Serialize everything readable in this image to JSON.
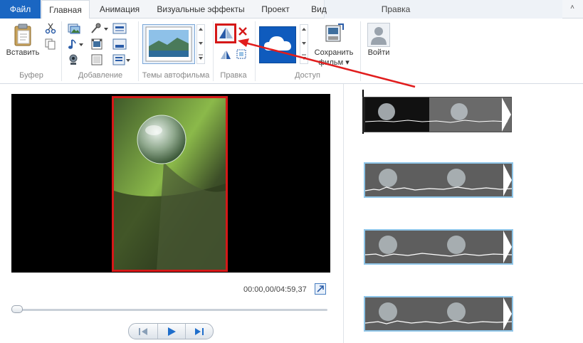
{
  "tabs": {
    "file": "Файл",
    "home": "Главная",
    "animation": "Анимация",
    "visual_effects": "Визуальные эффекты",
    "project": "Проект",
    "view": "Вид",
    "edit": "Правка"
  },
  "ribbon": {
    "clipboard": {
      "paste_label": "Вставить",
      "group": "Буфер"
    },
    "add": {
      "group": "Добавление"
    },
    "themes": {
      "group": "Темы автофильма"
    },
    "edit": {
      "group": "Правка"
    },
    "share": {
      "group": "Доступ"
    },
    "save_movie": {
      "line1": "Сохранить",
      "line2": "фильм ▾"
    },
    "sign_in": {
      "label": "Войти"
    }
  },
  "preview": {
    "time": "00:00,00/04:59,37"
  },
  "colors": {
    "file_tab": "#1a66c2",
    "highlight": "#d51818",
    "clip_border": "#8ec5e8",
    "onedrive": "#0f5bbd"
  },
  "icons": [
    "paste-icon",
    "cut-icon",
    "copy-icon",
    "add-photo-icon",
    "music-icon",
    "webcam-icon",
    "narration-icon",
    "snapshot-icon",
    "caption-icon",
    "title-icon",
    "credits-icon",
    "rotate-left-icon",
    "rotate-right-icon",
    "remove-icon",
    "select-all-icon",
    "onedrive-icon",
    "save-movie-icon",
    "user-icon",
    "fullscreen-icon",
    "prev-frame-icon",
    "play-icon",
    "next-frame-icon"
  ]
}
